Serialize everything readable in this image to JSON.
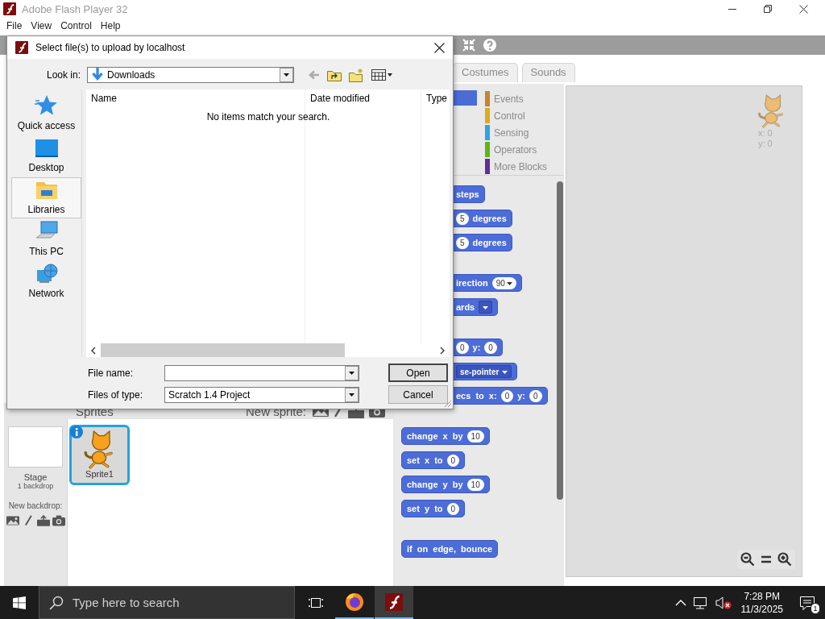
{
  "window": {
    "title": "Adobe Flash Player 32"
  },
  "menu": [
    "File",
    "View",
    "Control",
    "Help"
  ],
  "scratch": {
    "tabs": [
      {
        "label": "Costumes",
        "selected": false
      },
      {
        "label": "Sounds",
        "selected": false
      }
    ],
    "categories": {
      "left": [
        {
          "color": "#4a6cd4",
          "selected": true
        }
      ],
      "right": [
        {
          "label": "Events",
          "color": "#c88330",
          "selected": false
        },
        {
          "label": "Control",
          "color": "#e1a91a",
          "selected": false
        },
        {
          "label": "Sensing",
          "color": "#2ca5e2",
          "selected": false
        },
        {
          "label": "Operators",
          "color": "#5cb712",
          "selected": false
        },
        {
          "label": "More Blocks",
          "color": "#632d99",
          "selected": false
        }
      ]
    },
    "block_groups": [
      [
        {
          "cut": true,
          "parts": [
            {
              "kind": "text",
              "text": "steps"
            }
          ]
        },
        {
          "cut": true,
          "parts": [
            {
              "kind": "number",
              "text": "5"
            },
            {
              "kind": "text",
              "text": "degrees"
            }
          ]
        },
        {
          "cut": true,
          "parts": [
            {
              "kind": "number",
              "text": "5"
            },
            {
              "kind": "text",
              "text": "degrees"
            }
          ]
        }
      ],
      [
        {
          "cut": true,
          "parts": [
            {
              "kind": "text",
              "text": "irection"
            },
            {
              "kind": "number_menu",
              "text": "90"
            }
          ]
        },
        {
          "cut": true,
          "parts": [
            {
              "kind": "text",
              "text": "ards"
            },
            {
              "kind": "menu"
            }
          ]
        }
      ],
      [
        {
          "cut": true,
          "parts": [
            {
              "kind": "number",
              "text": "0"
            },
            {
              "kind": "text",
              "text": "y:"
            },
            {
              "kind": "number",
              "text": "0"
            }
          ]
        },
        {
          "cut": true,
          "parts": [
            {
              "kind": "menu",
              "text": "se-pointer"
            }
          ]
        },
        {
          "cut": true,
          "parts": [
            {
              "kind": "text",
              "text": "ecs to x:"
            },
            {
              "kind": "number",
              "text": "0"
            },
            {
              "kind": "text",
              "text": "y:"
            },
            {
              "kind": "number",
              "text": "0"
            }
          ]
        }
      ],
      [
        {
          "cut": false,
          "parts": [
            {
              "kind": "text",
              "text": "change x by"
            },
            {
              "kind": "number",
              "text": "10"
            }
          ]
        },
        {
          "cut": false,
          "parts": [
            {
              "kind": "text",
              "text": "set x to"
            },
            {
              "kind": "number",
              "text": "0"
            }
          ]
        },
        {
          "cut": false,
          "parts": [
            {
              "kind": "text",
              "text": "change y by"
            },
            {
              "kind": "number",
              "text": "10"
            }
          ]
        },
        {
          "cut": false,
          "parts": [
            {
              "kind": "text",
              "text": "set y to"
            },
            {
              "kind": "number",
              "text": "0"
            }
          ]
        }
      ],
      [
        {
          "cut": false,
          "parts": [
            {
              "kind": "text",
              "text": "if on edge, bounce"
            }
          ]
        }
      ]
    ],
    "sprite_info": {
      "x": "x: 0",
      "y": "y: 0"
    },
    "sprites_pane": {
      "title": "Sprites",
      "new_sprite": "New sprite:",
      "stage": {
        "label": "Stage",
        "backdrops": "1 backdrop",
        "new_backdrop": "New backdrop:"
      },
      "sprites": [
        {
          "name": "Sprite1",
          "selected": true
        }
      ]
    }
  },
  "dialog": {
    "title": "Select file(s) to upload by localhost",
    "look_in": {
      "label": "Look in:",
      "value": "Downloads"
    },
    "places": [
      {
        "kind": "star",
        "label": "Quick access",
        "selected": false
      },
      {
        "kind": "desktop",
        "label": "Desktop",
        "selected": false
      },
      {
        "kind": "library",
        "label": "Libraries",
        "selected": true
      },
      {
        "kind": "pc",
        "label": "This PC",
        "selected": false
      },
      {
        "kind": "network",
        "label": "Network",
        "selected": false
      }
    ],
    "columns": [
      "Name",
      "Date modified",
      "Type"
    ],
    "empty_message": "No items match your search.",
    "file_name": {
      "label": "File name:"
    },
    "file_type": {
      "label": "Files of type:",
      "value": "Scratch 1.4 Project"
    },
    "buttons": [
      {
        "label": "Open",
        "default": true
      },
      {
        "label": "Cancel",
        "default": false
      }
    ]
  },
  "taskbar": {
    "search_placeholder": "Type here to search",
    "apps": [
      {
        "kind": "firefox",
        "active": false
      },
      {
        "kind": "flash",
        "active": true
      }
    ],
    "time": "7:28 PM",
    "date": "11/3/2025",
    "notifications": "1"
  }
}
